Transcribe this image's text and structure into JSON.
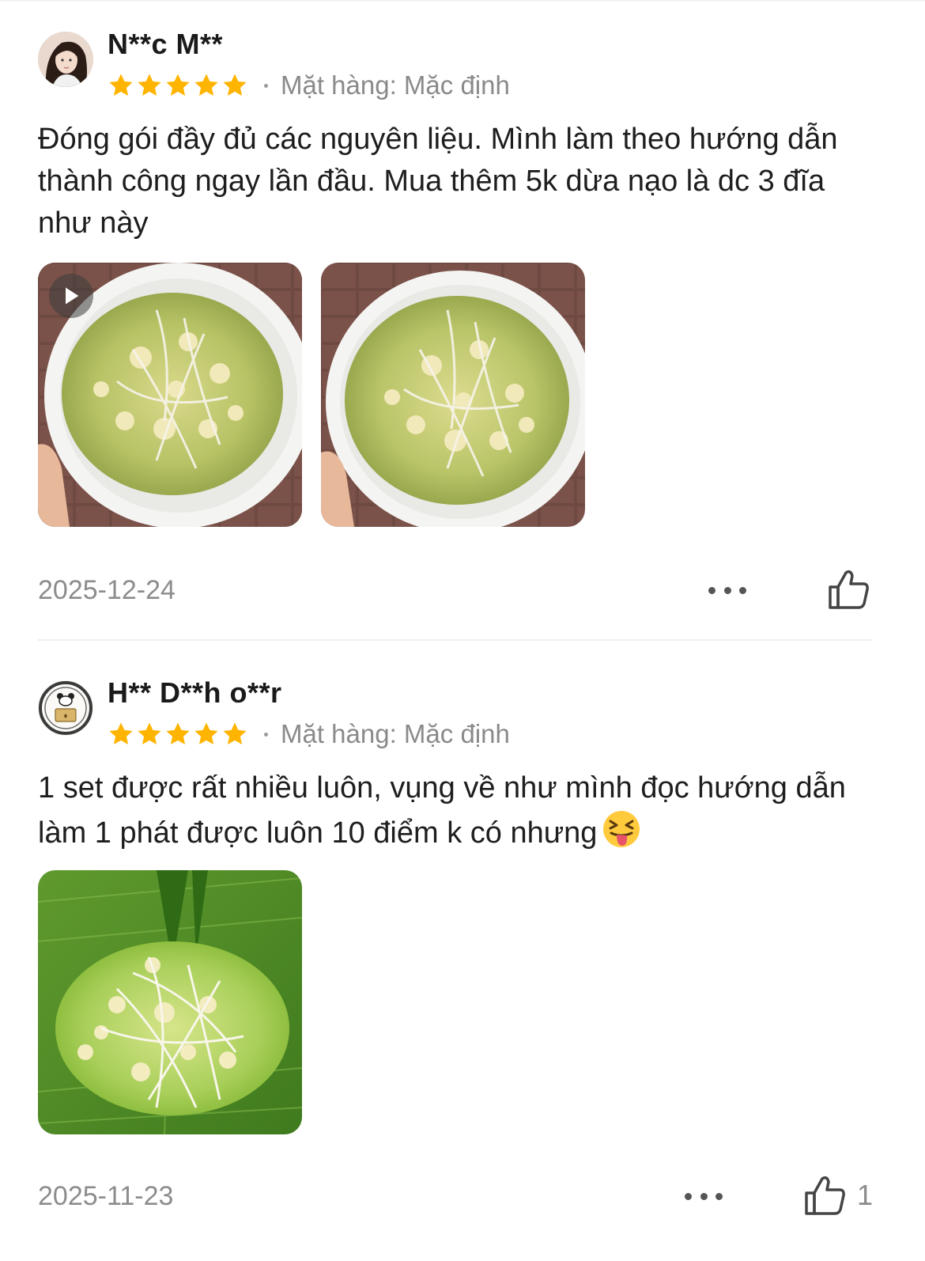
{
  "reviews": [
    {
      "author": "N**c M**",
      "rating": 5,
      "variant_label": "Mặt hàng: Mặc định",
      "text": "Đóng gói đầy đủ các nguyên liệu. Mình làm theo hướng dẫn thành công ngay lần đầu. Mua thêm 5k dừa nạo là dc 3 đĩa như này",
      "media": [
        {
          "type": "video",
          "icon": "play-icon"
        },
        {
          "type": "image"
        }
      ],
      "date": "2025-12-24",
      "like_count": ""
    },
    {
      "author": "H** D**h o**r",
      "rating": 5,
      "variant_label": "Mặt hàng: Mặc định",
      "text": "1 set  được rất nhiều luôn, vụng về như mình đọc hướng dẫn làm 1 phát  được luôn 10 điểm k có nhưng",
      "emoji": "😝",
      "media": [
        {
          "type": "image"
        }
      ],
      "date": "2025-11-23",
      "like_count": "1"
    }
  ],
  "colors": {
    "star": "#FFB400",
    "muted_text": "#8C8C8C",
    "divider": "#EFEFEF"
  },
  "icons": {
    "more": "more-horizontal-icon",
    "like": "thumbs-up-icon",
    "star": "star-icon"
  }
}
